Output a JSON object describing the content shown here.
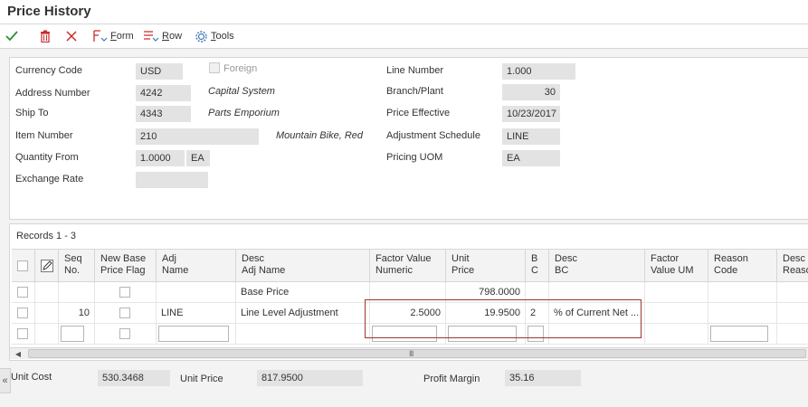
{
  "window": {
    "title": "Price History"
  },
  "toolbar": {
    "ok_icon": "check-icon",
    "delete_icon": "trash-icon",
    "cancel_icon": "close-icon",
    "form_label": "Form",
    "row_label": "Row",
    "tools_label": "Tools"
  },
  "header": {
    "currency_code": {
      "label": "Currency Code",
      "value": "USD"
    },
    "foreign": {
      "label": "Foreign",
      "checked": false
    },
    "address_number": {
      "label": "Address Number",
      "value": "4242",
      "desc": "Capital System"
    },
    "ship_to": {
      "label": "Ship To",
      "value": "4343",
      "desc": "Parts Emporium"
    },
    "item_number": {
      "label": "Item Number",
      "value": "210",
      "desc": "Mountain Bike, Red"
    },
    "quantity_from": {
      "label": "Quantity From",
      "value": "1.0000",
      "uom": "EA"
    },
    "exchange_rate": {
      "label": "Exchange Rate",
      "value": ""
    },
    "line_number": {
      "label": "Line Number",
      "value": "1.000"
    },
    "branch_plant": {
      "label": "Branch/Plant",
      "value": "30"
    },
    "price_effective": {
      "label": "Price Effective",
      "value": "10/23/2017"
    },
    "adjustment_schedule": {
      "label": "Adjustment Schedule",
      "value": "LINE"
    },
    "pricing_uom": {
      "label": "Pricing UOM",
      "value": "EA"
    }
  },
  "grid": {
    "records_label": "Records 1 - 3",
    "columns": [
      {
        "key": "seq",
        "line1": "Seq",
        "line2": "No."
      },
      {
        "key": "new_base",
        "line1": "New Base",
        "line2": "Price Flag"
      },
      {
        "key": "adj_name",
        "line1": "Adj",
        "line2": "Name"
      },
      {
        "key": "desc_adj",
        "line1": "Desc",
        "line2": "Adj Name"
      },
      {
        "key": "factor",
        "line1": "Factor Value",
        "line2": "Numeric"
      },
      {
        "key": "unit_price",
        "line1": "Unit",
        "line2": "Price"
      },
      {
        "key": "bc",
        "line1": "B",
        "line2": "C"
      },
      {
        "key": "desc_bc",
        "line1": "Desc",
        "line2": "BC"
      },
      {
        "key": "factor_um",
        "line1": "Factor",
        "line2": "Value UM"
      },
      {
        "key": "reason",
        "line1": "Reason",
        "line2": "Code"
      },
      {
        "key": "desc_reason",
        "line1": "Desc",
        "line2": "Reaso"
      }
    ],
    "rows": [
      {
        "seq": "",
        "adj_name": "",
        "desc_adj": "Base Price",
        "factor": "",
        "unit_price": "798.0000",
        "bc": "",
        "desc_bc": ""
      },
      {
        "seq": "10",
        "adj_name": "LINE",
        "desc_adj": "Line Level Adjustment",
        "factor": "2.5000",
        "unit_price": "19.9500",
        "bc": "2",
        "desc_bc": "% of Current Net ..."
      }
    ],
    "scroll_grip": "III"
  },
  "footer": {
    "unit_cost": {
      "label": "Unit Cost",
      "value": "530.3468"
    },
    "unit_price": {
      "label": "Unit Price",
      "value": "817.9500"
    },
    "profit_margin": {
      "label": "Profit Margin",
      "value": "35.16"
    }
  },
  "colors": {
    "ok": "#2e8b2e",
    "delete": "#cc2a2a",
    "accent": "#3b78b8",
    "highlight_border": "#a0352d"
  }
}
